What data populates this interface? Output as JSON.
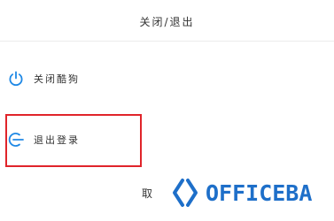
{
  "dialog": {
    "title": "关闭/退出"
  },
  "options": {
    "shutdown": {
      "label": "关闭酷狗",
      "icon": "power-icon"
    },
    "logout": {
      "label": "退出登录",
      "icon": "logout-icon"
    }
  },
  "cancel": {
    "label": "取"
  },
  "watermark": {
    "text": "OFFICEBA"
  },
  "colors": {
    "accent": "#1e88e5",
    "highlight": "#e0242a",
    "watermark": "#1e6fc9"
  }
}
